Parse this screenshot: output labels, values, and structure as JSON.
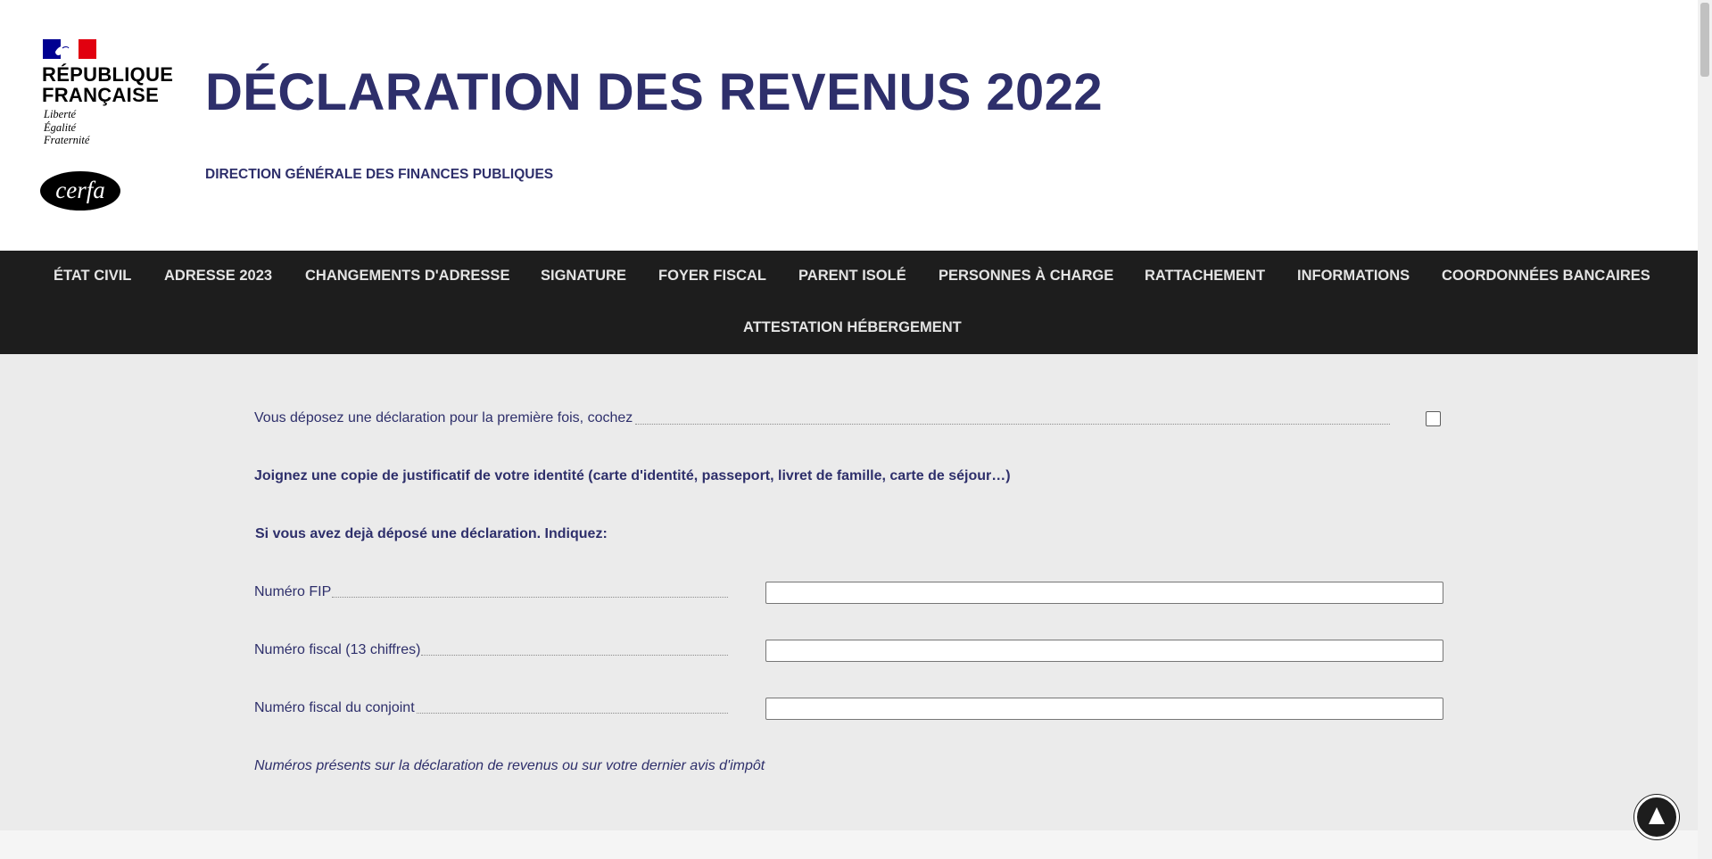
{
  "header": {
    "republique_line1": "RÉPUBLIQUE",
    "republique_line2": "FRANÇAISE",
    "devise": [
      "Liberté",
      "Égalité",
      "Fraternité"
    ],
    "cerfa_logo": "cerfa",
    "title": "DÉCLARATION DES REVENUS 2022",
    "subtitle": "DIRECTION GÉNÉRALE DES FINANCES PUBLIQUES"
  },
  "nav": {
    "items": [
      "ÉTAT CIVIL",
      "ADRESSE 2023",
      "CHANGEMENTS D'ADRESSE",
      "SIGNATURE",
      "FOYER FISCAL",
      "PARENT ISOLÉ",
      "PERSONNES À CHARGE",
      "RATTACHEMENT",
      "INFORMATIONS",
      "COORDONNÉES BANCAIRES",
      "ATTESTATION HÉBERGEMENT"
    ]
  },
  "form": {
    "first_time_label": "Vous déposez une déclaration pour la première fois, cochez",
    "first_time_checked": false,
    "id_copy_notice": "Joignez une copie de justificatif de votre identité (carte d'identité, passeport, livret de famille, carte de séjour…)",
    "already_filed_heading": "Si vous avez dejà déposé une déclaration. Indiquez:",
    "fields": [
      {
        "label": "Numéro FIP",
        "value": "",
        "placeholder": ""
      },
      {
        "label": "Numéro fiscal (13 chiffres)",
        "value": "",
        "placeholder": ""
      },
      {
        "label": "Numéro fiscal du conjoint",
        "value": "",
        "placeholder": ""
      }
    ],
    "note": "Numéros présents sur la déclaration de revenus ou sur votre dernier avis d'impôt"
  },
  "icons": {
    "scroll_top": "arrow-up-icon",
    "marianne": "marianne-flag-icon",
    "cerfa": "cerfa-logo"
  },
  "colors": {
    "brand_blue": "#2e2f6b",
    "nav_bg": "#1d1d1d",
    "content_bg": "#ebebeb",
    "flag_blue": "#000091",
    "flag_red": "#e1000f"
  }
}
